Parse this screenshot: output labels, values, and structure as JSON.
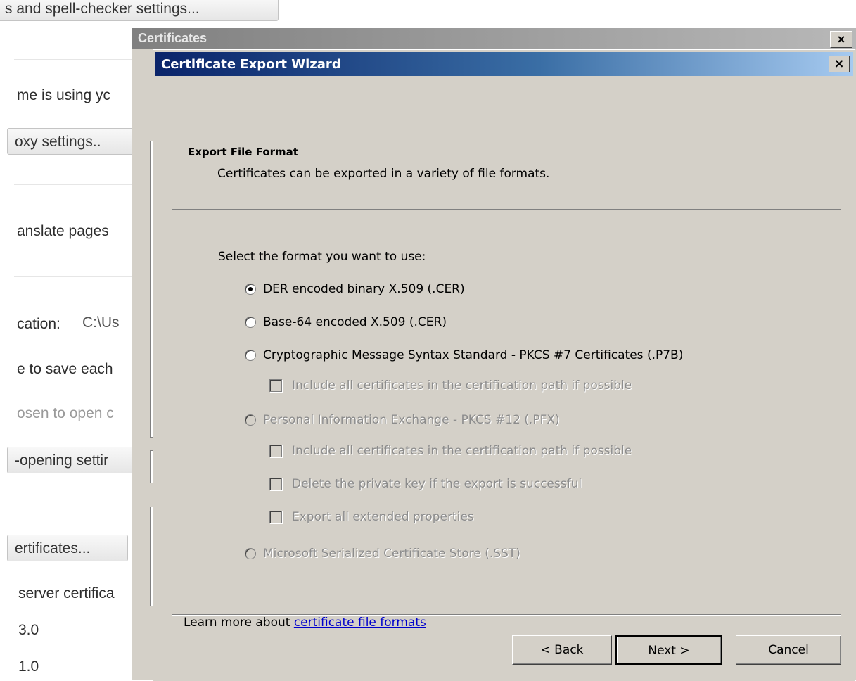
{
  "background": {
    "spell_button": "s and spell-checker settings...",
    "proxy_text": "me is using yc",
    "proxy_button": "oxy settings..",
    "translate_text": "anslate pages",
    "location_label": "cation:",
    "location_value": "C:\\Us",
    "save_each_text": "e to save each",
    "chosen_text": "osen to open c",
    "auto_open_button": "-opening settir",
    "certificates_button": "ertificates...",
    "server_cert_text": "server certifica",
    "ssl3_text": "3.0",
    "tls_text": "1.0"
  },
  "certificates_window": {
    "title": "Certificates",
    "close_glyph": "×"
  },
  "wizard": {
    "title": "Certificate Export Wizard",
    "close_glyph": "×",
    "heading": "Export File Format",
    "subheading": "Certificates can be exported in a variety of file formats.",
    "prompt": "Select the format you want to use:",
    "options": {
      "der": "DER encoded binary X.509 (.CER)",
      "base64": "Base-64 encoded X.509 (.CER)",
      "pkcs7": "Cryptographic Message Syntax Standard - PKCS #7 Certificates (.P7B)",
      "pkcs7_include_all": "Include all certificates in the certification path if possible",
      "pfx": "Personal Information Exchange - PKCS #12 (.PFX)",
      "pfx_include_all": "Include all certificates in the certification path if possible",
      "pfx_delete_key": "Delete the private key if the export is successful",
      "pfx_export_props": "Export all extended properties",
      "sst": "Microsoft Serialized Certificate Store (.SST)"
    },
    "selected_option": "der",
    "learn_more_prefix": "Learn more about ",
    "learn_more_link": "certificate file formats",
    "buttons": {
      "back": "< Back",
      "next": "Next >",
      "cancel": "Cancel"
    }
  }
}
